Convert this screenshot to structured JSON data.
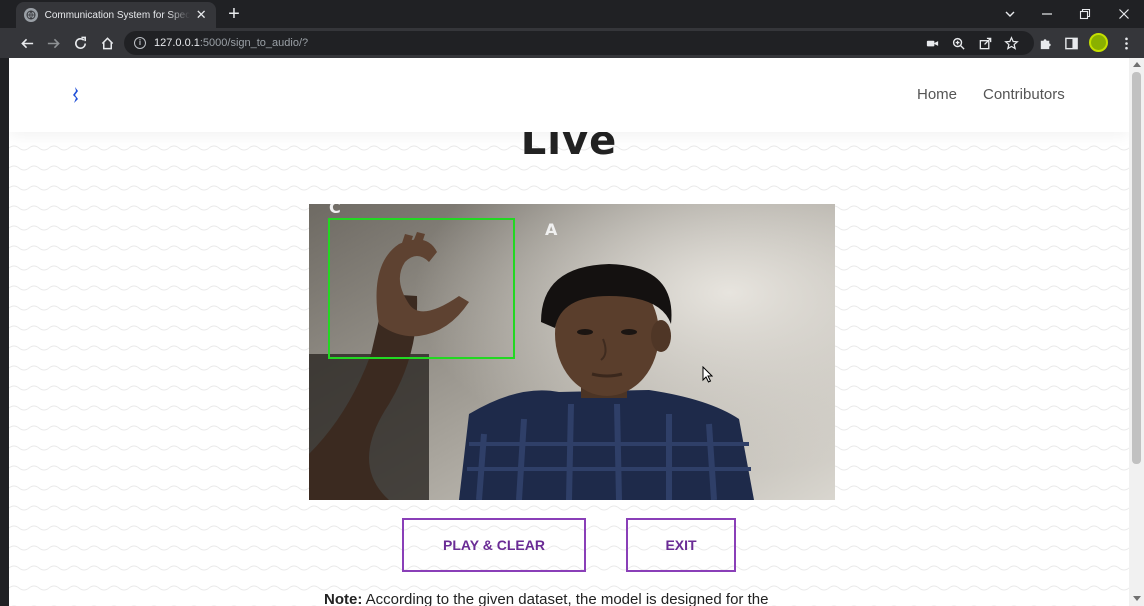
{
  "browser": {
    "tab_title": "Communication System for Specially Abled",
    "tab_close": "✕",
    "new_tab": "+",
    "url_host": "127.0.0.1",
    "url_path": ":5000/sign_to_audio/?",
    "info_glyph": "i"
  },
  "nav": {
    "links": [
      "Home",
      "Contributors"
    ]
  },
  "page": {
    "heading": "Live",
    "video": {
      "letter_top": "C",
      "letter_mid": "A"
    },
    "buttons": {
      "play_clear": "PLAY & CLEAR",
      "exit": "EXIT"
    },
    "note_label": "Note:",
    "note_text": "According to the given dataset, the model is designed for the"
  },
  "colors": {
    "button_border": "#8a3fb8",
    "roi_box": "#22d822",
    "logo": "#1f4fd8"
  }
}
